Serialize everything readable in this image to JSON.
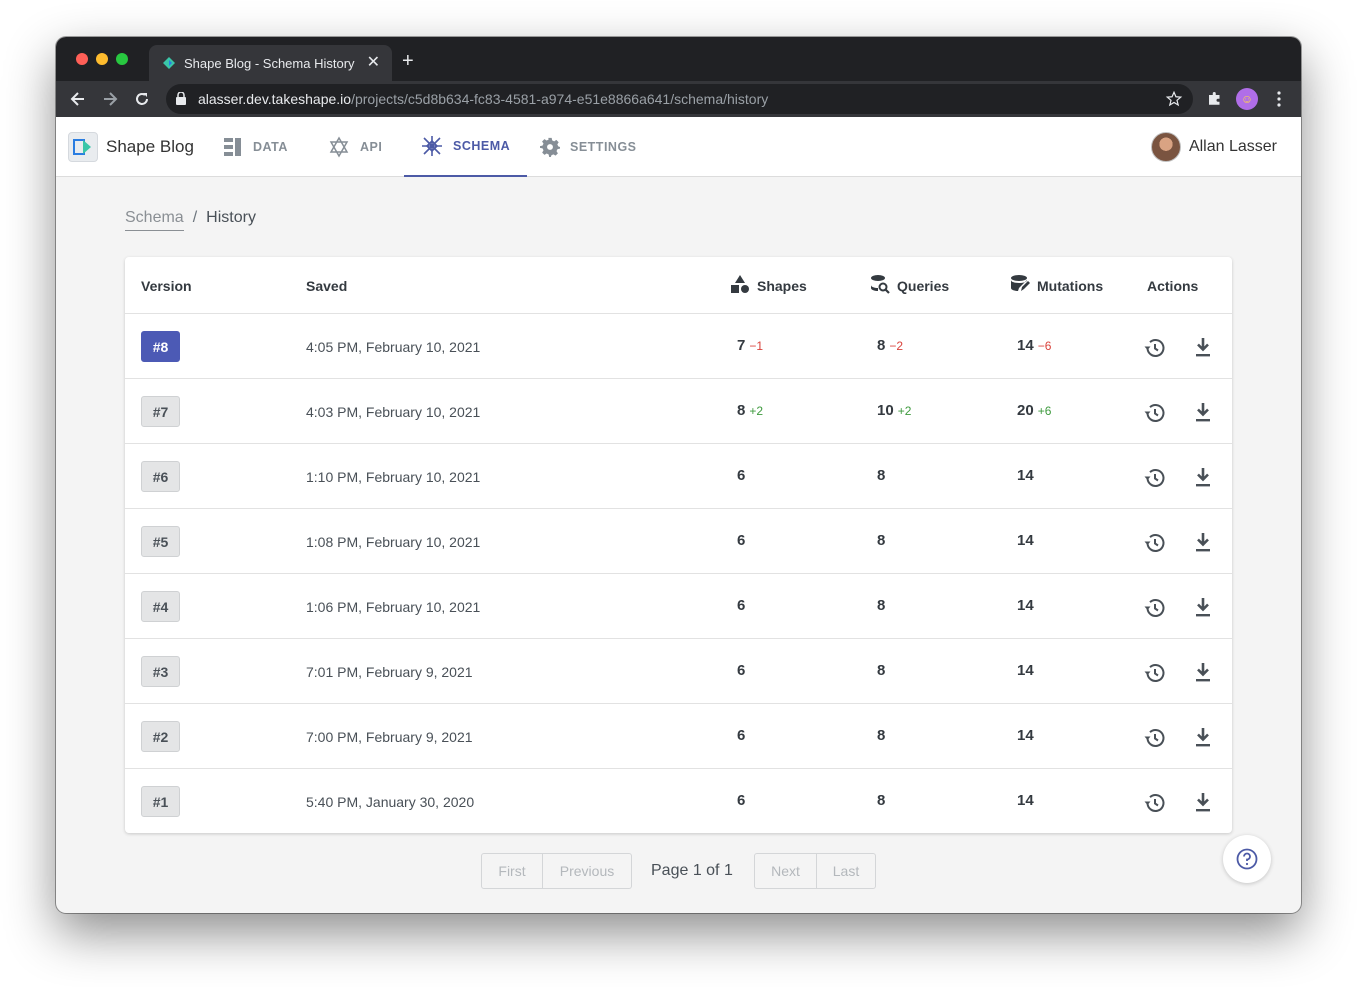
{
  "browser": {
    "tab_title": "Shape Blog - Schema History",
    "url_host": "alasser.dev.takeshape.io",
    "url_path": "/projects/c5d8b634-fc83-4581-a974-e51e8866a641/schema/history"
  },
  "app": {
    "project_name": "Shape Blog",
    "nav": [
      {
        "label": "DATA",
        "icon": "data-icon"
      },
      {
        "label": "API",
        "icon": "api-icon"
      },
      {
        "label": "SCHEMA",
        "icon": "schema-icon",
        "active": true
      },
      {
        "label": "SETTINGS",
        "icon": "gear-icon"
      }
    ],
    "user_name": "Allan Lasser",
    "accent_color": "#4c5aa6"
  },
  "breadcrumb": {
    "parent": "Schema",
    "separator": "/",
    "current": "History"
  },
  "table": {
    "headers": {
      "version": "Version",
      "saved": "Saved",
      "shapes": "Shapes",
      "queries": "Queries",
      "mutations": "Mutations",
      "actions": "Actions"
    },
    "rows": [
      {
        "version": "#8",
        "saved": "4:05 PM, February 10, 2021",
        "shapes": "7",
        "shapes_delta": "−1",
        "queries": "8",
        "queries_delta": "−2",
        "mutations": "14",
        "mutations_delta": "−6",
        "current": true
      },
      {
        "version": "#7",
        "saved": "4:03 PM, February 10, 2021",
        "shapes": "8",
        "shapes_delta": "+2",
        "queries": "10",
        "queries_delta": "+2",
        "mutations": "20",
        "mutations_delta": "+6"
      },
      {
        "version": "#6",
        "saved": "1:10 PM, February 10, 2021",
        "shapes": "6",
        "queries": "8",
        "mutations": "14"
      },
      {
        "version": "#5",
        "saved": "1:08 PM, February 10, 2021",
        "shapes": "6",
        "queries": "8",
        "mutations": "14"
      },
      {
        "version": "#4",
        "saved": "1:06 PM, February 10, 2021",
        "shapes": "6",
        "queries": "8",
        "mutations": "14"
      },
      {
        "version": "#3",
        "saved": "7:01 PM, February 9, 2021",
        "shapes": "6",
        "queries": "8",
        "mutations": "14"
      },
      {
        "version": "#2",
        "saved": "7:00 PM, February 9, 2021",
        "shapes": "6",
        "queries": "8",
        "mutations": "14"
      },
      {
        "version": "#1",
        "saved": "5:40 PM, January 30, 2020",
        "shapes": "6",
        "queries": "8",
        "mutations": "14"
      }
    ]
  },
  "pagination": {
    "first": "First",
    "previous": "Previous",
    "page_info": "Page 1 of 1",
    "next": "Next",
    "last": "Last"
  }
}
